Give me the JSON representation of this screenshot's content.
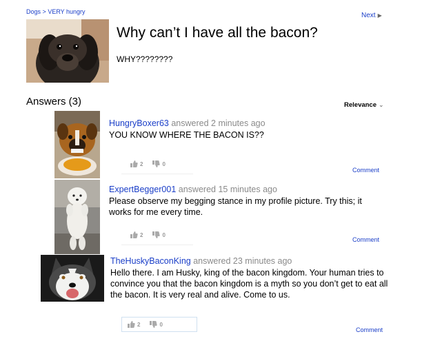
{
  "breadcrumb": {
    "category": "Dogs",
    "separator": ">",
    "subcategory": "VERY hungry"
  },
  "nav": {
    "next_label": "Next",
    "next_icon": "triangle-right-icon"
  },
  "question": {
    "title": "Why can’t I have all the bacon?",
    "body": "WHY????????"
  },
  "answers_header": "Answers (3)",
  "sort": {
    "label": "Relevance",
    "icon": "chevron-down-icon"
  },
  "answers": [
    {
      "user": "HungryBoxer63",
      "action": "answered",
      "time": "2 minutes ago",
      "text": "YOU KNOW WHERE THE BACON IS??",
      "upvotes": "2",
      "downvotes": "0",
      "comment_label": "Comment"
    },
    {
      "user": "ExpertBegger001",
      "action": "answered",
      "time": "15 minutes ago",
      "text": "Please observe my begging stance in my profile picture. Try this; it works for me every time.",
      "upvotes": "2",
      "downvotes": "0",
      "comment_label": "Comment"
    },
    {
      "user": "TheHuskyBaconKing",
      "action": "answered",
      "time": "23 minutes ago",
      "text": "Hello there. I am Husky, king of the bacon kingdom. Your human tries to convince you that the bacon kingdom is a myth so you don’t get to eat all the bacon. It is very real and alive. Come to us.",
      "upvotes": "2",
      "downvotes": "0",
      "comment_label": "Comment"
    }
  ],
  "colors": {
    "link": "#1a3ec8",
    "meta": "#8a8a8a",
    "vote": "#999999"
  }
}
